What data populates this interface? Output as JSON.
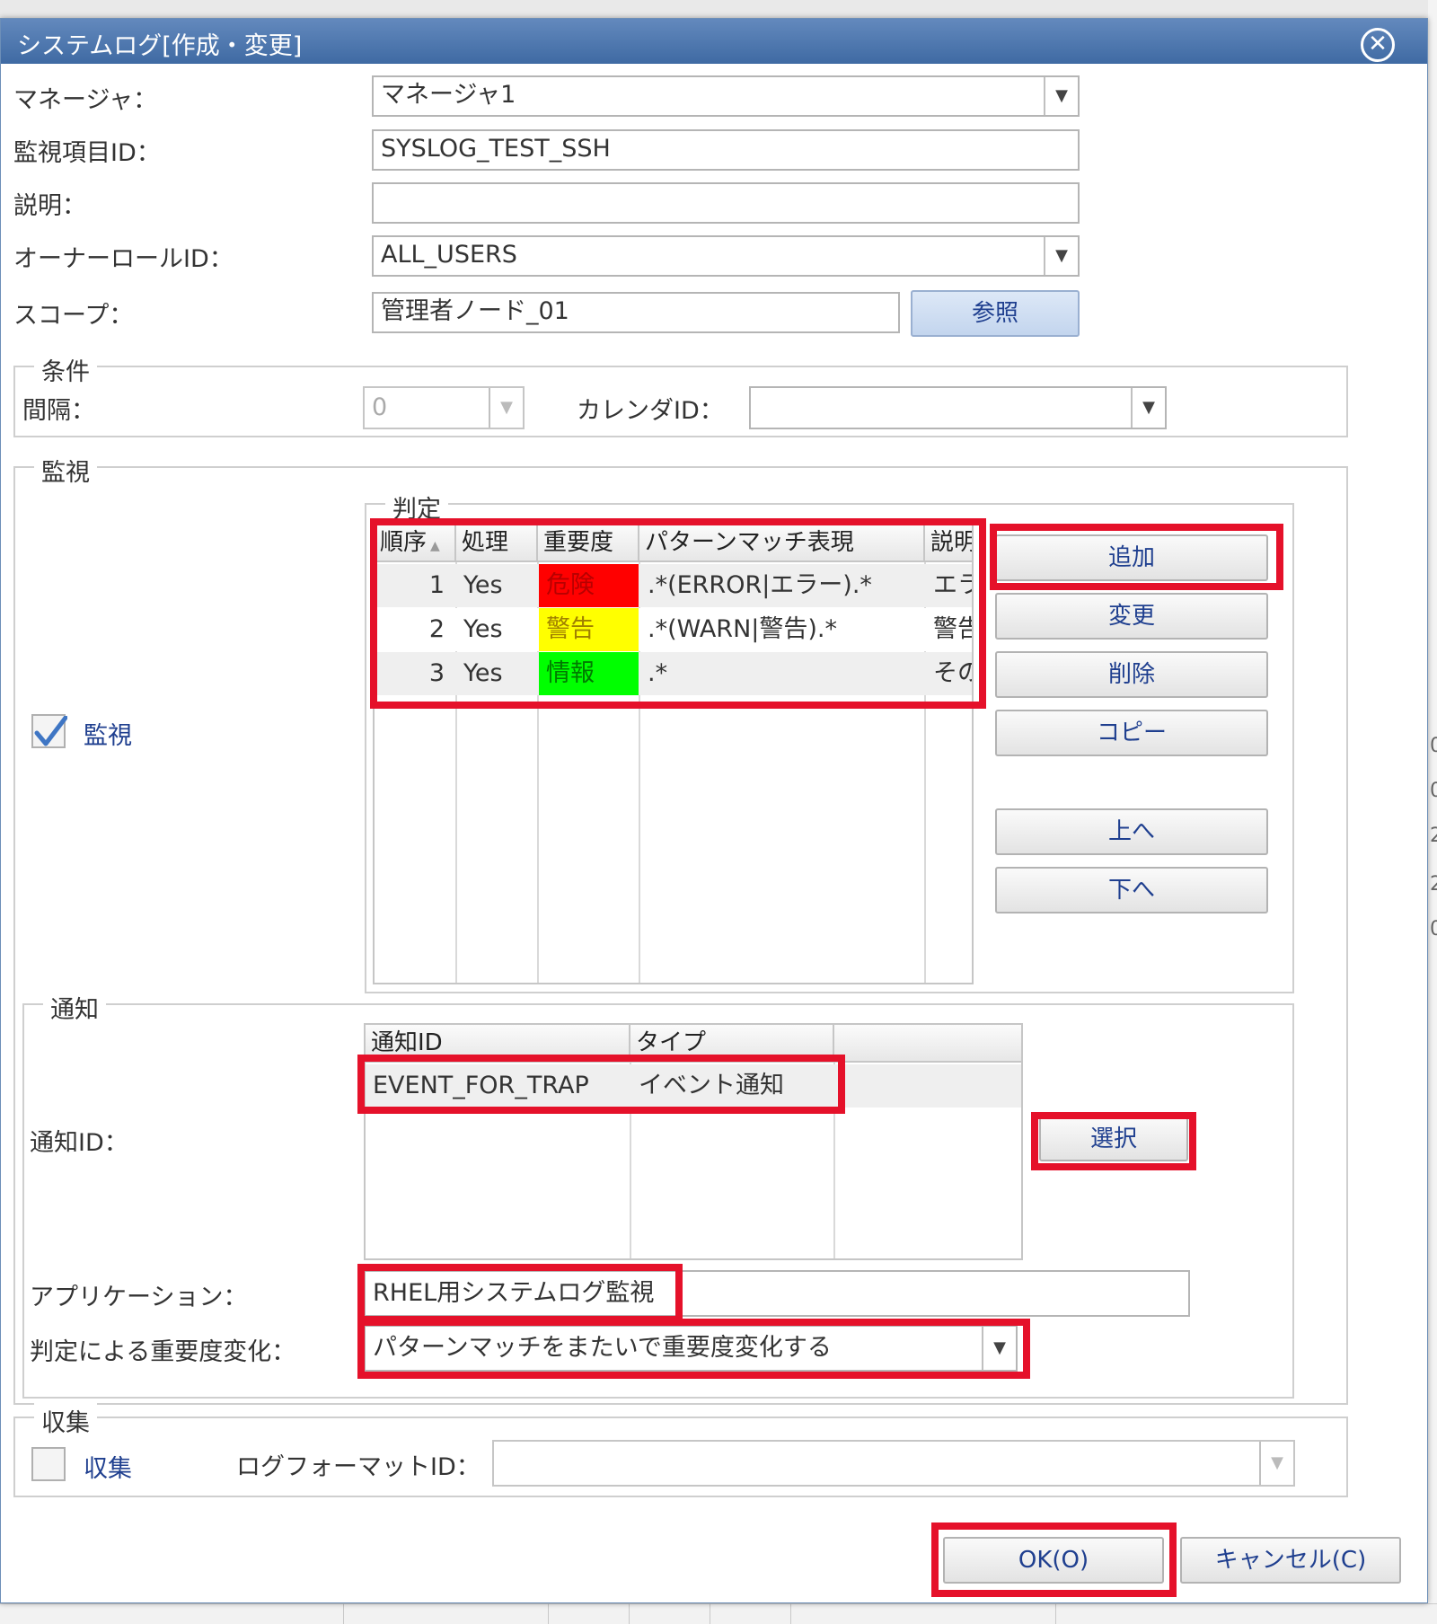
{
  "dialog": {
    "title": "システムログ[作成・変更]",
    "close_symbol": "✕"
  },
  "form": {
    "manager_label": "マネージャ：",
    "manager_value": "マネージャ1",
    "monitor_id_label": "監視項目ID：",
    "monitor_id_value": "SYSLOG_TEST_SSH",
    "description_label": "説明：",
    "description_value": "",
    "owner_label": "オーナーロールID：",
    "owner_value": "ALL_USERS",
    "scope_label": "スコープ：",
    "scope_value": "管理者ノード_01",
    "scope_button": "参照"
  },
  "conditions": {
    "legend": "条件",
    "interval_label": "間隔：",
    "interval_value": "0",
    "calendar_label": "カレンダID：",
    "calendar_value": ""
  },
  "monitor": {
    "legend": "監視",
    "checkbox_label": "監視",
    "checked": true,
    "judgement_legend": "判定",
    "columns": [
      "順序",
      "処理",
      "重要度",
      "パターンマッチ表現",
      "説明"
    ],
    "rows": [
      {
        "order": "1",
        "process": "Yes",
        "priority": "危険",
        "priority_color": "#ff0000",
        "pattern": ".*(ERROR|エラー).*",
        "desc": "エラ"
      },
      {
        "order": "2",
        "process": "Yes",
        "priority": "警告",
        "priority_color": "#ffff00",
        "pattern": ".*(WARN|警告).*",
        "desc": "警告"
      },
      {
        "order": "3",
        "process": "Yes",
        "priority": "情報",
        "priority_color": "#00ff00",
        "pattern": ".*",
        "desc": "その"
      }
    ],
    "buttons": {
      "add": "追加",
      "modify": "変更",
      "delete": "削除",
      "copy": "コピー",
      "up": "上へ",
      "down": "下へ"
    }
  },
  "notify": {
    "legend": "通知",
    "id_label": "通知ID：",
    "columns": [
      "通知ID",
      "タイプ"
    ],
    "rows": [
      {
        "id": "EVENT_FOR_TRAP",
        "type": "イベント通知"
      }
    ],
    "select_button": "選択",
    "application_label": "アプリケーション：",
    "application_value": "RHEL用システムログ監視",
    "priority_change_label": "判定による重要度変化：",
    "priority_change_value": "パターンマッチをまたいで重要度変化する"
  },
  "collect": {
    "legend": "収集",
    "checkbox_label": "収集",
    "checked": false,
    "log_format_label": "ログフォーマットID：",
    "log_format_value": ""
  },
  "footer": {
    "ok": "OK(O)",
    "cancel": "キャンセル(C)"
  },
  "background": {
    "edge_chars": [
      "0",
      "0",
      "2",
      "2",
      "0"
    ]
  },
  "colors": {
    "titlebar": "#4a74ad",
    "highlight": "#e5112a",
    "button_text": "#1f3f8f"
  }
}
